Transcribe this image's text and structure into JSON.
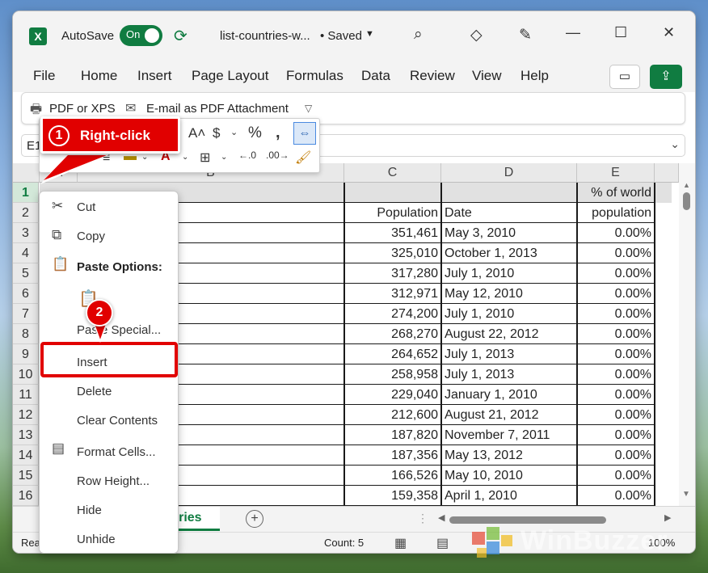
{
  "titlebar": {
    "autosave_label": "AutoSave",
    "autosave_state": "On",
    "filename": "list-countries-w...",
    "saved_status": "• Saved",
    "icons": [
      "excel-logo-icon",
      "sync-save-icon",
      "search-icon",
      "diamond-icon",
      "pen-sparkle-icon",
      "minimize-icon",
      "maximize-icon",
      "close-icon"
    ],
    "minimize": "—",
    "maximize": "☐",
    "close": "✕"
  },
  "menu": {
    "items": [
      "File",
      "Home",
      "Insert",
      "Page Layout",
      "Formulas",
      "Data",
      "Review",
      "View",
      "Help"
    ]
  },
  "ribbon": {
    "pdf_xps": "PDF or XPS",
    "email_pdf": "E-mail as PDF Attachment"
  },
  "formula_bar": {
    "name_box": "E1"
  },
  "columns": [
    "A",
    "B",
    "C",
    "D",
    "E"
  ],
  "rows": [
    {
      "num": "1",
      "b": "",
      "c": "",
      "d": "",
      "e": "% of world"
    },
    {
      "num": "2",
      "b": "endent territory)",
      "c": "Population",
      "d": "Date",
      "e": "population"
    },
    {
      "num": "3",
      "b": "",
      "c": "351,461",
      "d": "May 3, 2010",
      "e": "0.00%"
    },
    {
      "num": "4",
      "b": "nland)",
      "c": "325,010",
      "d": "October 1, 2013",
      "e": "0.00%"
    },
    {
      "num": "5",
      "b": "",
      "c": "317,280",
      "d": "July 1, 2010",
      "e": "0.00%"
    },
    {
      "num": "6",
      "b": "",
      "c": "312,971",
      "d": "May 12, 2010",
      "e": "0.00%"
    },
    {
      "num": "7",
      "b": "n (USA)",
      "c": "274,200",
      "d": "July 1, 2010",
      "e": "0.00%"
    },
    {
      "num": "8",
      "b": "",
      "c": "268,270",
      "d": "August 22, 2012",
      "e": "0.00%"
    },
    {
      "num": "9",
      "b": "",
      "c": "264,652",
      "d": "July 1, 2013",
      "e": "0.00%"
    },
    {
      "num": "10",
      "b": "",
      "c": "258,958",
      "d": "July 1, 2013",
      "e": "0.00%"
    },
    {
      "num": "11",
      "b": "buda",
      "c": "229,040",
      "d": "January 1, 2010",
      "e": "0.00%"
    },
    {
      "num": "12",
      "b": "",
      "c": "212,600",
      "d": "August 21, 2012",
      "e": "0.00%"
    },
    {
      "num": "13",
      "b": "",
      "c": "187,820",
      "d": "November 7, 2011",
      "e": "0.00%"
    },
    {
      "num": "14",
      "b": "nds)",
      "c": "187,356",
      "d": "May 13, 2012",
      "e": "0.00%"
    },
    {
      "num": "15",
      "b": "",
      "c": "166,526",
      "d": "May 10, 2010",
      "e": "0.00%"
    },
    {
      "num": "16",
      "b": "",
      "c": "159,358",
      "d": "April 1, 2010",
      "e": "0.00%"
    }
  ],
  "sheet_tab": {
    "label": "ntries",
    "add": "+"
  },
  "status": {
    "ready": "Rea",
    "count": "Count: 5",
    "zoom": "100%"
  },
  "callouts": {
    "step1_num": "1",
    "step1_text": "Right-click",
    "step2_num": "2"
  },
  "context_menu": {
    "cut": "Cut",
    "copy": "Copy",
    "paste_options": "Paste Options:",
    "paste_special": "Paste Special...",
    "insert": "Insert",
    "delete": "Delete",
    "clear_contents": "Clear Contents",
    "format_cells": "Format Cells...",
    "row_height": "Row Height...",
    "hide": "Hide",
    "unhide": "Unhide"
  },
  "watermark": {
    "text": "WinBuzzer"
  },
  "colors": {
    "excel_green": "#107c41",
    "callout_red": "#e10000",
    "selection_gray": "#e1e1e1"
  }
}
